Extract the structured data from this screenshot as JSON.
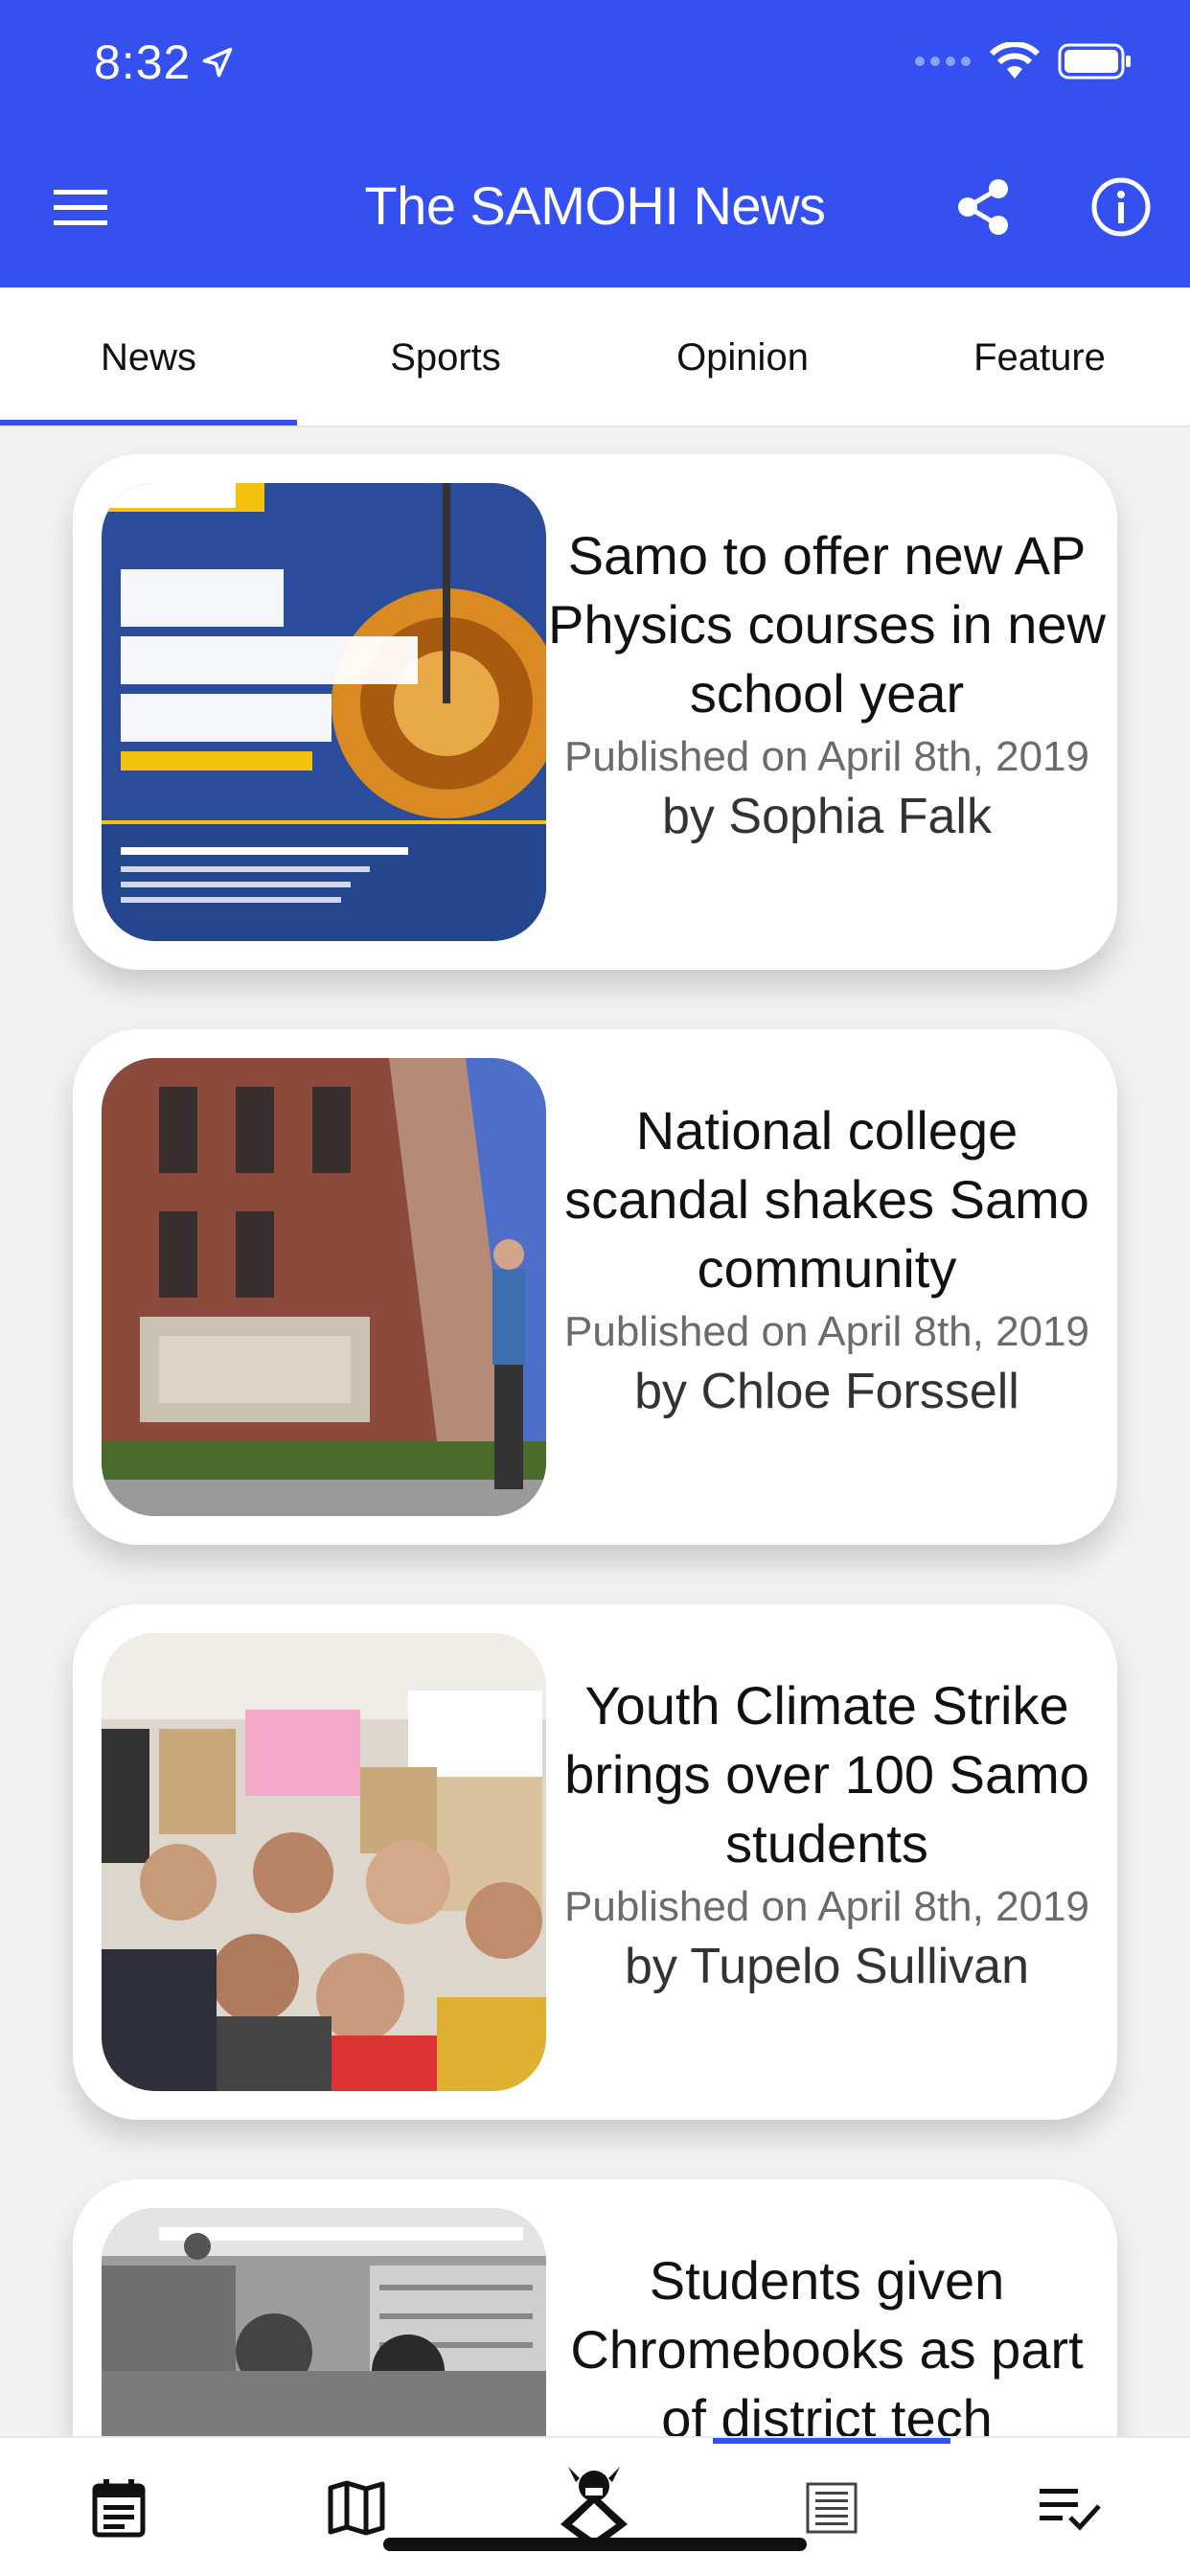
{
  "status_bar": {
    "time": "8:32"
  },
  "header": {
    "title": "The SAMOHI News",
    "icons": [
      "menu-icon",
      "share-icon",
      "info-icon"
    ]
  },
  "tabs": [
    {
      "label": "News",
      "selected": true
    },
    {
      "label": "Sports",
      "selected": false
    },
    {
      "label": "Opinion",
      "selected": false
    },
    {
      "label": "Feature",
      "selected": false
    }
  ],
  "articles": [
    {
      "headline": "Samo to offer new AP Physics courses in new school year",
      "published": "Published on April 8th, 2019",
      "byline": "by Sophia Falk"
    },
    {
      "headline": "National college scandal shakes Samo community",
      "published": "Published on April 8th, 2019",
      "byline": "by Chloe Forssell"
    },
    {
      "headline": "Youth Climate Strike brings over 100 Samo students",
      "published": "Published on April 8th, 2019",
      "byline": "by Tupelo Sullivan"
    },
    {
      "headline": "Students given Chromebooks as part of district tech",
      "published": "",
      "byline": ""
    }
  ],
  "bottom_nav": [
    {
      "icon": "calendar-icon",
      "selected": false
    },
    {
      "icon": "map-icon",
      "selected": false
    },
    {
      "icon": "viking-logo-icon",
      "selected": false
    },
    {
      "icon": "newspaper-icon",
      "selected": true
    },
    {
      "icon": "playlist-check-icon",
      "selected": false
    }
  ],
  "colors": {
    "primary": "#3450f0",
    "background": "#f2f2f2"
  }
}
